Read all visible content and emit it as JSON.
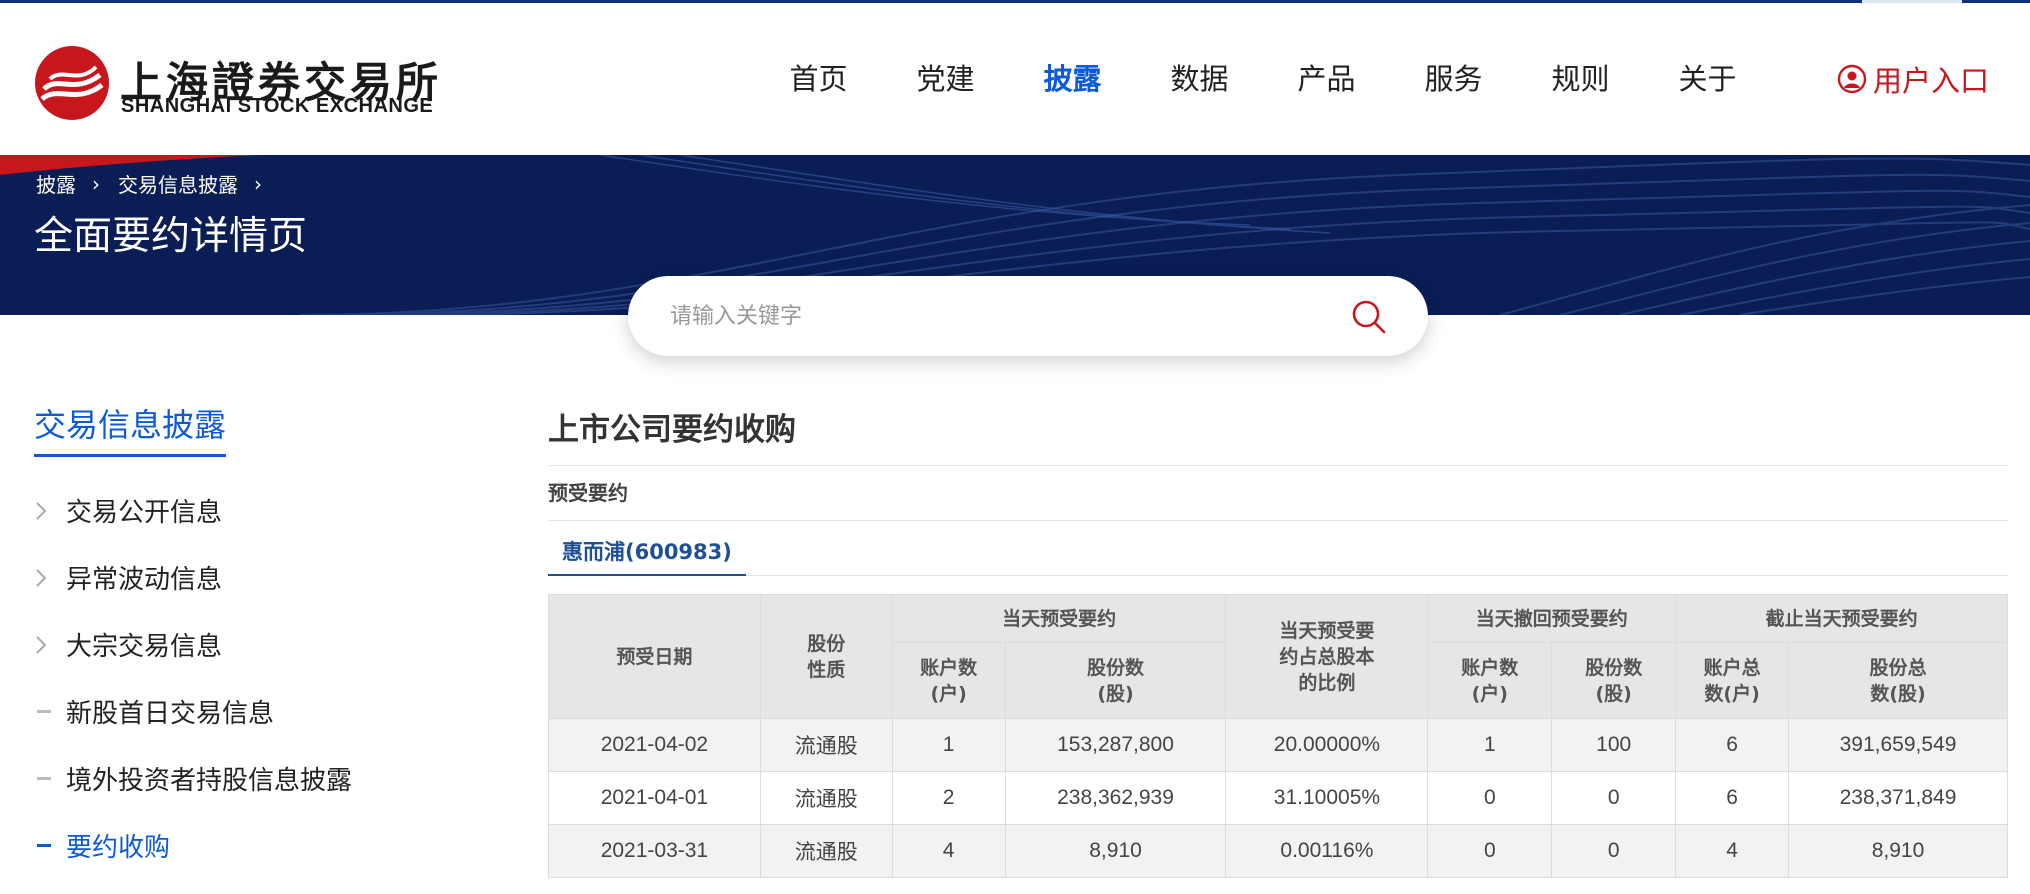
{
  "logo": {
    "cn": "上海證券交易所",
    "en": "SHANGHAI STOCK EXCHANGE"
  },
  "nav": {
    "items": [
      {
        "label": "首页"
      },
      {
        "label": "党建"
      },
      {
        "label": "披露",
        "active": true
      },
      {
        "label": "数据"
      },
      {
        "label": "产品"
      },
      {
        "label": "服务"
      },
      {
        "label": "规则"
      },
      {
        "label": "关于"
      }
    ],
    "user_entry": "用户入口"
  },
  "breadcrumb": [
    "披露",
    "交易信息披露"
  ],
  "page_title": "全面要约详情页",
  "search": {
    "placeholder": "请输入关键字"
  },
  "sidebar": {
    "title": "交易信息披露",
    "items": [
      {
        "label": "交易公开信息",
        "marker": "chevron"
      },
      {
        "label": "异常波动信息",
        "marker": "chevron"
      },
      {
        "label": "大宗交易信息",
        "marker": "chevron"
      },
      {
        "label": "新股首日交易信息",
        "marker": "dash"
      },
      {
        "label": "境外投资者持股信息披露",
        "marker": "dash"
      },
      {
        "label": "要约收购",
        "marker": "dash",
        "active": true
      }
    ]
  },
  "main": {
    "title": "上市公司要约收购",
    "subtitle": "预受要约",
    "tab": "惠而浦(600983)"
  },
  "table": {
    "headers": {
      "date": "预受日期",
      "share_type": "股份\n性质",
      "group_today": "当天预受要约",
      "today_accounts": "账户数\n(户)",
      "today_shares": "股份数\n(股)",
      "ratio": "当天预受要\n约占总股本\n的比例",
      "group_withdraw": "当天撤回预受要约",
      "withdraw_accounts": "账户数\n(户)",
      "withdraw_shares": "股份数\n(股)",
      "group_total": "截止当天预受要约",
      "total_accounts": "账户总\n数(户)",
      "total_shares": "股份总\n数(股)"
    },
    "rows": [
      [
        "2021-04-02",
        "流通股",
        "1",
        "153,287,800",
        "20.00000%",
        "1",
        "100",
        "6",
        "391,659,549"
      ],
      [
        "2021-04-01",
        "流通股",
        "2",
        "238,362,939",
        "31.10005%",
        "0",
        "0",
        "6",
        "238,371,849"
      ],
      [
        "2021-03-31",
        "流通股",
        "4",
        "8,910",
        "0.00116%",
        "0",
        "0",
        "4",
        "8,910"
      ]
    ]
  },
  "colors": {
    "brand_red": "#c8161d",
    "accent_blue": "#0c5ad6",
    "banner_navy": "#0a1d54"
  }
}
